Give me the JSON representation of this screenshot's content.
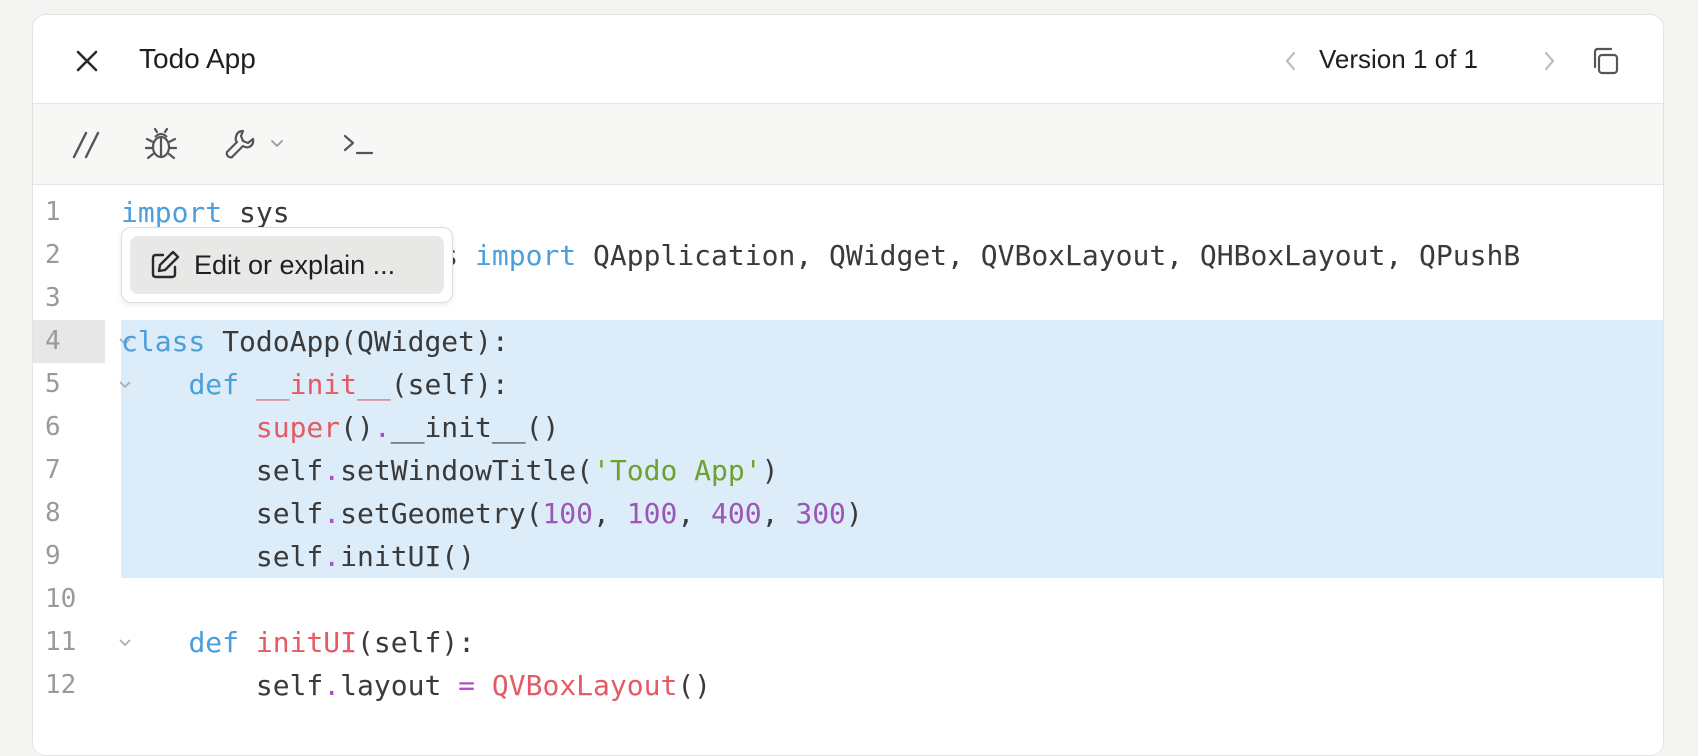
{
  "header": {
    "title": "Todo App",
    "version_label": "Version 1 of 1"
  },
  "toolbar": {
    "tools": [
      "comment-icon",
      "bug-icon",
      "wrench-icon",
      "terminal-icon"
    ]
  },
  "popup": {
    "label": "Edit or explain ..."
  },
  "editor": {
    "selected_lines": [
      4,
      5,
      6,
      7,
      8,
      9
    ],
    "line_numbers": [
      "1",
      "2",
      "3",
      "4",
      "5",
      "6",
      "7",
      "8",
      "9",
      "10",
      "11",
      "12"
    ],
    "lines": [
      "import sys",
      "from PyQt5.QtWidgets import QApplication, QWidget, QVBoxLayout, QHBoxLayout, QPushB",
      "",
      "class TodoApp(QWidget):",
      "    def __init__(self):",
      "        super().__init__()",
      "        self.setWindowTitle('Todo App')",
      "        self.setGeometry(100, 100, 400, 300)",
      "        self.initUI()",
      "",
      "    def initUI(self):",
      "        self.layout = QVBoxLayout()"
    ]
  },
  "colors": {
    "keyword": "#4a9fdc",
    "function": "#e55a63",
    "string": "#6fa12f",
    "number": "#9b57b5",
    "selection": "#dcecf9"
  }
}
